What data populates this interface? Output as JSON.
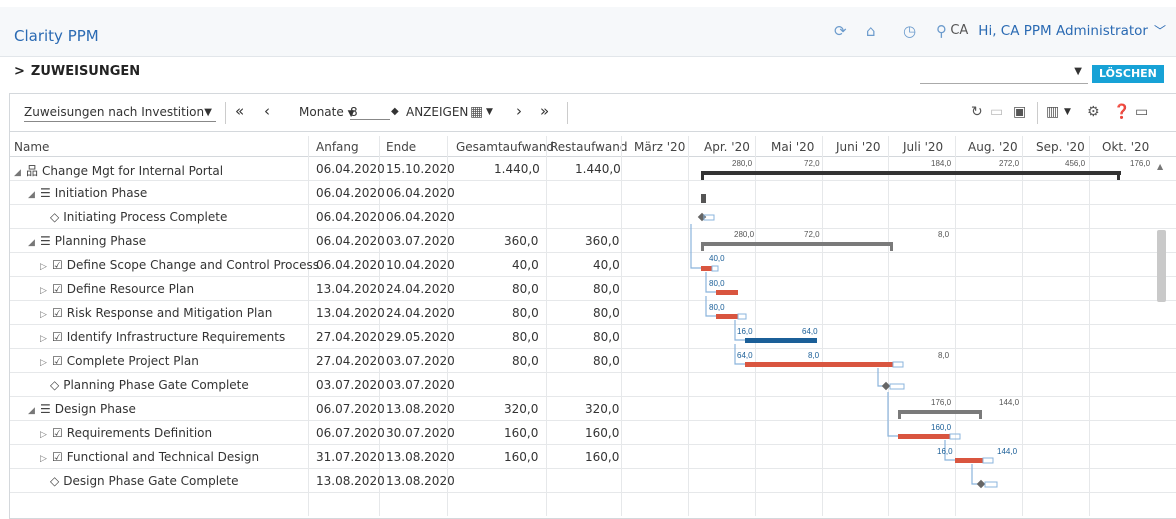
{
  "header": {
    "app_title": "Clarity PPM",
    "user_initials": "CA",
    "user_greeting": "Hi, CA PPM Administrator"
  },
  "section": {
    "title": "ZUWEISUNGEN",
    "delete_label": "LÖSCHEN"
  },
  "toolbar": {
    "view_select": "Zuweisungen nach Investition",
    "period_unit": "Monate",
    "period_count": "8",
    "show_label": "ANZEIGEN"
  },
  "columns": {
    "name": "Name",
    "start": "Anfang",
    "end": "Ende",
    "total_effort": "Gesamtaufwand",
    "remaining_effort": "Restaufwand",
    "months": [
      "März '20",
      "Apr. '20",
      "Mai '20",
      "Juni '20",
      "Juli '20",
      "Aug. '20",
      "Sep. '20",
      "Okt. '20"
    ]
  },
  "rows": [
    {
      "name": "Change Mgt for Internal Portal",
      "start": "06.04.2020",
      "end": "15.10.2020",
      "total": "1.440,0",
      "remaining": "1.440,0",
      "type": "project",
      "indent": 0
    },
    {
      "name": "Initiation Phase",
      "start": "06.04.2020",
      "end": "06.04.2020",
      "total": "",
      "remaining": "",
      "type": "phase",
      "indent": 1
    },
    {
      "name": "Initiating Process Complete",
      "start": "06.04.2020",
      "end": "06.04.2020",
      "total": "",
      "remaining": "",
      "type": "milestone",
      "indent": 2
    },
    {
      "name": "Planning Phase",
      "start": "06.04.2020",
      "end": "03.07.2020",
      "total": "360,0",
      "remaining": "360,0",
      "type": "phase",
      "indent": 1
    },
    {
      "name": "Define Scope Change and Control Process",
      "start": "06.04.2020",
      "end": "10.04.2020",
      "total": "40,0",
      "remaining": "40,0",
      "type": "task",
      "indent": 2
    },
    {
      "name": "Define Resource Plan",
      "start": "13.04.2020",
      "end": "24.04.2020",
      "total": "80,0",
      "remaining": "80,0",
      "type": "task",
      "indent": 2
    },
    {
      "name": "Risk Response and Mitigation Plan",
      "start": "13.04.2020",
      "end": "24.04.2020",
      "total": "80,0",
      "remaining": "80,0",
      "type": "task",
      "indent": 2
    },
    {
      "name": "Identify Infrastructure Requirements",
      "start": "27.04.2020",
      "end": "29.05.2020",
      "total": "80,0",
      "remaining": "80,0",
      "type": "task",
      "indent": 2
    },
    {
      "name": "Complete Project Plan",
      "start": "27.04.2020",
      "end": "03.07.2020",
      "total": "80,0",
      "remaining": "80,0",
      "type": "task",
      "indent": 2
    },
    {
      "name": "Planning Phase Gate Complete",
      "start": "03.07.2020",
      "end": "03.07.2020",
      "total": "",
      "remaining": "",
      "type": "milestone",
      "indent": 2
    },
    {
      "name": "Design Phase",
      "start": "06.07.2020",
      "end": "13.08.2020",
      "total": "320,0",
      "remaining": "320,0",
      "type": "phase",
      "indent": 1
    },
    {
      "name": "Requirements Definition",
      "start": "06.07.2020",
      "end": "30.07.2020",
      "total": "160,0",
      "remaining": "160,0",
      "type": "task",
      "indent": 2
    },
    {
      "name": "Functional and Technical Design",
      "start": "31.07.2020",
      "end": "13.08.2020",
      "total": "160,0",
      "remaining": "160,0",
      "type": "task",
      "indent": 2
    },
    {
      "name": "Design Phase Gate Complete",
      "start": "13.08.2020",
      "end": "13.08.2020",
      "total": "",
      "remaining": "",
      "type": "milestone",
      "indent": 2
    }
  ],
  "gantt_labels": {
    "project": [
      "280,0",
      "72,0",
      "184,0",
      "272,0",
      "456,0",
      "176,0"
    ],
    "planning": [
      "280,0",
      "72,0",
      "8,0"
    ],
    "define_scope": "40,0",
    "define_resource": "80,0",
    "risk_response": "80,0",
    "identify_infra": [
      "16,0",
      "64,0"
    ],
    "complete_plan": [
      "64,0",
      "8,0",
      "8,0"
    ],
    "design_phase": [
      "176,0",
      "144,0"
    ],
    "requirements": "160,0",
    "functional": [
      "16,0",
      "144,0"
    ]
  },
  "colors": {
    "accent": "#2a6ab3",
    "delete_button": "#17a2d6",
    "task_bar": "#d9553f",
    "progress_bar": "#1b5f98",
    "summary_bar": "#7a7a7a",
    "project_bar": "#333333",
    "link": "#8bb4dc"
  }
}
